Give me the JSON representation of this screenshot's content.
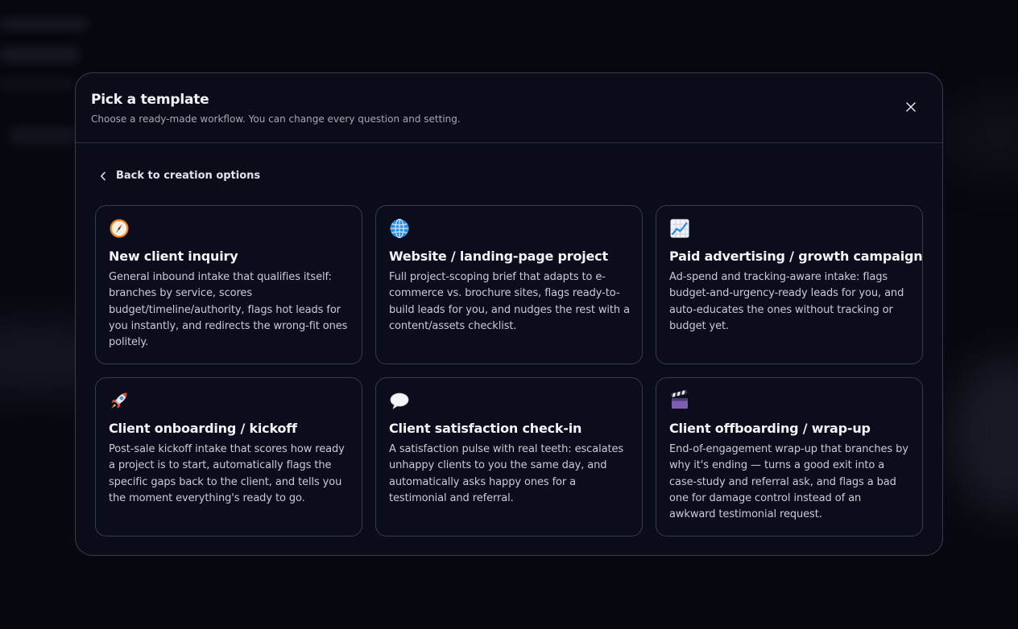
{
  "modal": {
    "title": "Pick a template",
    "subtitle": "Choose a ready-made workflow. You can change every question and setting.",
    "back_label": "Back to creation options"
  },
  "templates": [
    {
      "icon": "compass-icon",
      "title": "New client inquiry",
      "description": "General inbound intake that qualifies itself: branches by service, scores budget/timeline/authority, flags hot leads for you instantly, and redirects the wrong-fit ones politely."
    },
    {
      "icon": "globe-icon",
      "title": "Website / landing-page project",
      "description": "Full project-scoping brief that adapts to e-commerce vs. brochure sites, flags ready-to-build leads for you, and nudges the rest with a content/assets checklist."
    },
    {
      "icon": "chart-increasing-icon",
      "title": "Paid advertising / growth campaign",
      "description": "Ad-spend and tracking-aware intake: flags budget-and-urgency-ready leads for you, and auto-educates the ones without tracking or budget yet."
    },
    {
      "icon": "rocket-icon",
      "title": "Client onboarding / kickoff",
      "description": "Post-sale kickoff intake that scores how ready a project is to start, automatically flags the specific gaps back to the client, and tells you the moment everything's ready to go."
    },
    {
      "icon": "speech-bubble-icon",
      "title": "Client satisfaction check-in",
      "description": "A satisfaction pulse with real teeth: escalates unhappy clients to you the same day, and automatically asks happy ones for a testimonial and referral."
    },
    {
      "icon": "clapperboard-icon",
      "title": "Client offboarding / wrap-up",
      "description": "End-of-engagement wrap-up that branches by why it's ending — turns a good exit into a case-study and referral ask, and flags a bad one for damage control instead of an awkward testimonial request."
    }
  ],
  "colors": {
    "page_background": "#07080f",
    "modal_background": "#0b0c1a",
    "card_border": "#383b4b",
    "title_text": "#f3f4f8",
    "body_text": "#c9cbd6",
    "muted_text": "#a4a7b5"
  }
}
